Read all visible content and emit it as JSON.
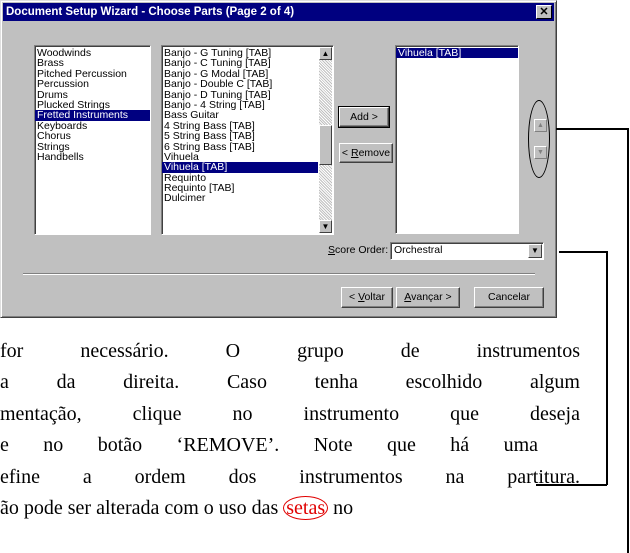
{
  "dialog": {
    "title": "Document Setup Wizard - Choose Parts (Page 2 of 4)",
    "close_glyph": "✕"
  },
  "families": {
    "items": [
      "Woodwinds",
      "Brass",
      "Pitched Percussion",
      "Percussion",
      "Drums",
      "Plucked Strings",
      "Fretted Instruments",
      "Keyboards",
      "Chorus",
      "Strings",
      "Handbells"
    ],
    "selected_index": 6
  },
  "instruments": {
    "items": [
      "Banjo - G Tuning [TAB]",
      "Banjo - C Tuning [TAB]",
      "Banjo - G Modal [TAB]",
      "Banjo - Double C [TAB]",
      "Banjo - D Tuning [TAB]",
      "Banjo - 4 String [TAB]",
      "Bass Guitar",
      "4 String Bass [TAB]",
      "5 String Bass [TAB]",
      "6 String Bass [TAB]",
      "Vihuela",
      "Vihuela [TAB]",
      "Requinto",
      "Requinto [TAB]",
      "Dulcimer"
    ],
    "selected_index": 11
  },
  "buttons": {
    "add": "Add >",
    "remove_prefix": "< ",
    "remove_underlined": "R",
    "remove_rest": "emove",
    "back_prefix": "< ",
    "back_underlined": "V",
    "back_rest": "oltar",
    "next_underlined": "A",
    "next_rest": "vançar >",
    "cancel": "Cancelar"
  },
  "selected_parts": {
    "items": [
      "Vihuela [TAB]"
    ],
    "selected_index": 0
  },
  "order_buttons": {
    "up_icon": "▲",
    "down_icon": "▼"
  },
  "score_order": {
    "label_underlined": "S",
    "label_rest": "core Order:",
    "value": "Orchestral"
  },
  "body_text": {
    "line1": "for necessário. O grupo de instrumentos",
    "line2": "a da direita. Caso tenha escolhido algum",
    "line3": "mentação, clique no instrumento que deseja",
    "line4": "e no botão ‘REMOVE’. Note que há uma",
    "line5": "efine a ordem dos instrumentos na partitura.",
    "line6_before": "ão pode ser alterada com o uso das ",
    "line6_highlight": "setas",
    "line6_after": " no"
  },
  "colors": {
    "selection": "#000080",
    "highlight": "#e00000",
    "dialog_face": "#c0c0c0"
  }
}
